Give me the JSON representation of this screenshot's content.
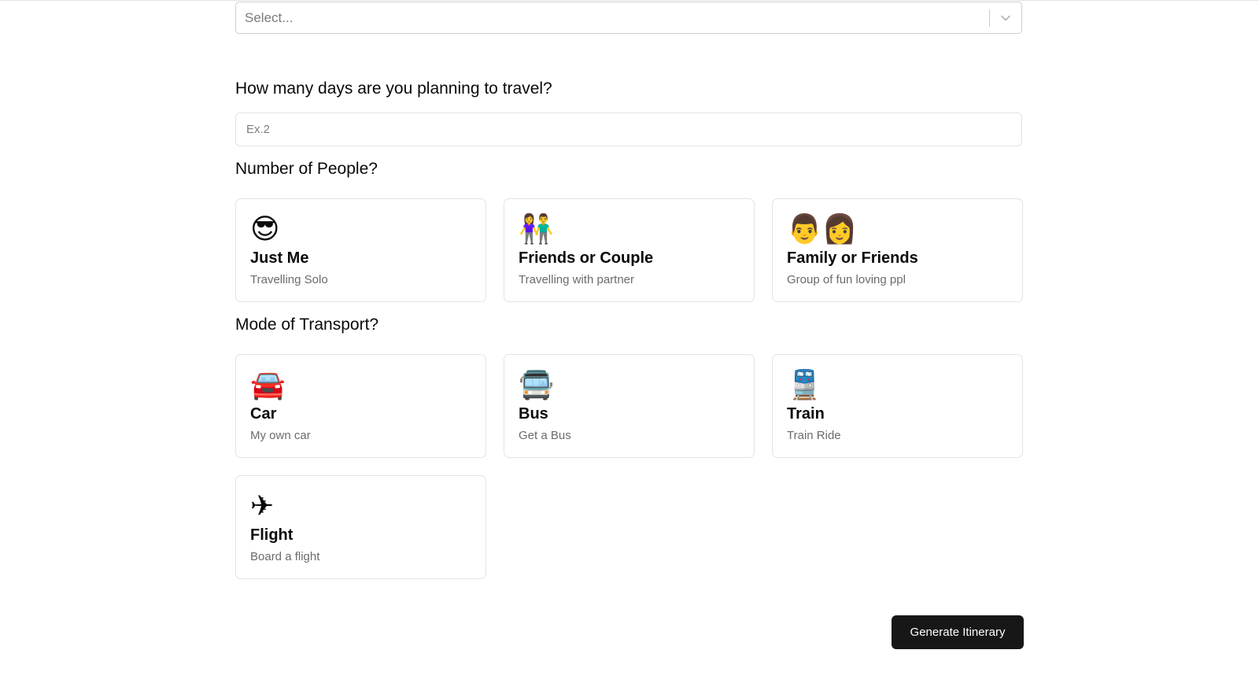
{
  "destination_select": {
    "placeholder": "Select..."
  },
  "days": {
    "question": "How many days are you planning to travel?",
    "placeholder": "Ex.2",
    "value": ""
  },
  "people": {
    "question": "Number of People?",
    "options": [
      {
        "icon": "😎",
        "icon_name": "sunglasses-face-icon",
        "title": "Just Me",
        "desc": "Travelling Solo"
      },
      {
        "icon": "👫",
        "icon_name": "couple-icon",
        "title": "Friends or Couple",
        "desc": "Travelling with partner"
      },
      {
        "icon": "👨👩",
        "icon_name": "family-icon",
        "title": "Family or Friends",
        "desc": "Group of fun loving ppl"
      }
    ]
  },
  "transport": {
    "question": "Mode of Transport?",
    "options": [
      {
        "icon": "🚘",
        "icon_name": "car-icon",
        "title": "Car",
        "desc": "My own car"
      },
      {
        "icon": "🚍",
        "icon_name": "bus-icon",
        "title": "Bus",
        "desc": "Get a Bus"
      },
      {
        "icon": "🚆",
        "icon_name": "train-icon",
        "title": "Train",
        "desc": "Train Ride"
      },
      {
        "icon": "✈",
        "icon_name": "airplane-icon",
        "title": "Flight",
        "desc": "Board a flight"
      }
    ]
  },
  "actions": {
    "generate_label": "Generate Itinerary"
  }
}
